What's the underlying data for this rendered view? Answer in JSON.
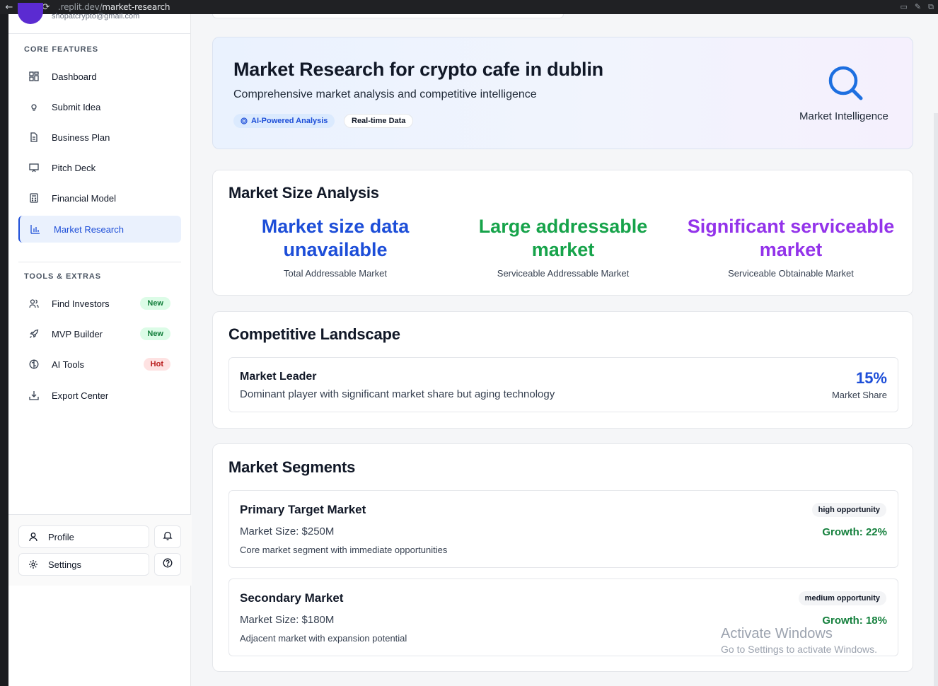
{
  "browser": {
    "url_prefix": ".replit.dev/",
    "url_path": "market-research"
  },
  "user": {
    "email": "shopatcrypto@gmail.com"
  },
  "sidebar": {
    "core_title": "CORE FEATURES",
    "core_items": [
      {
        "label": "Dashboard",
        "icon": "dashboard-icon"
      },
      {
        "label": "Submit Idea",
        "icon": "lightbulb-icon"
      },
      {
        "label": "Business Plan",
        "icon": "document-icon"
      },
      {
        "label": "Pitch Deck",
        "icon": "presentation-icon"
      },
      {
        "label": "Financial Model",
        "icon": "calculator-icon"
      },
      {
        "label": "Market Research",
        "icon": "bar-chart-icon",
        "active": true
      }
    ],
    "tools_title": "TOOLS & EXTRAS",
    "tools_items": [
      {
        "label": "Find Investors",
        "icon": "users-icon",
        "badge": "New"
      },
      {
        "label": "MVP Builder",
        "icon": "rocket-icon",
        "badge": "New"
      },
      {
        "label": "AI Tools",
        "icon": "brain-icon",
        "badge": "Hot"
      },
      {
        "label": "Export Center",
        "icon": "download-icon"
      }
    ],
    "profile_label": "Profile",
    "settings_label": "Settings"
  },
  "hero": {
    "title": "Market Research for crypto cafe in dublin",
    "subtitle": "Comprehensive market analysis and competitive intelligence",
    "pill_ai": "AI-Powered Analysis",
    "pill_realtime": "Real-time Data",
    "icon_label": "Market Intelligence"
  },
  "market_size": {
    "title": "Market Size Analysis",
    "columns": [
      {
        "value": "Market size data unavailable",
        "label": "Total Addressable Market",
        "color": "#1d4ed8"
      },
      {
        "value": "Large addressable market",
        "label": "Serviceable Addressable Market",
        "color": "#16a34a"
      },
      {
        "value": "Significant serviceable market",
        "label": "Serviceable Obtainable Market",
        "color": "#9333ea"
      }
    ]
  },
  "competitive": {
    "title": "Competitive Landscape",
    "competitors": [
      {
        "name": "Market Leader",
        "description": "Dominant player with significant market share but aging technology",
        "share": "15%",
        "share_label": "Market Share"
      }
    ]
  },
  "segments": {
    "title": "Market Segments",
    "items": [
      {
        "name": "Primary Target Market",
        "size": "Market Size: $250M",
        "description": "Core market segment with immediate opportunities",
        "opportunity": "high opportunity",
        "growth": "Growth: 22%"
      },
      {
        "name": "Secondary Market",
        "size": "Market Size: $180M",
        "description": "Adjacent market with expansion potential",
        "opportunity": "medium opportunity",
        "growth": "Growth: 18%"
      }
    ]
  },
  "watermark": {
    "line1": "Activate Windows",
    "line2": "Go to Settings to activate Windows."
  }
}
